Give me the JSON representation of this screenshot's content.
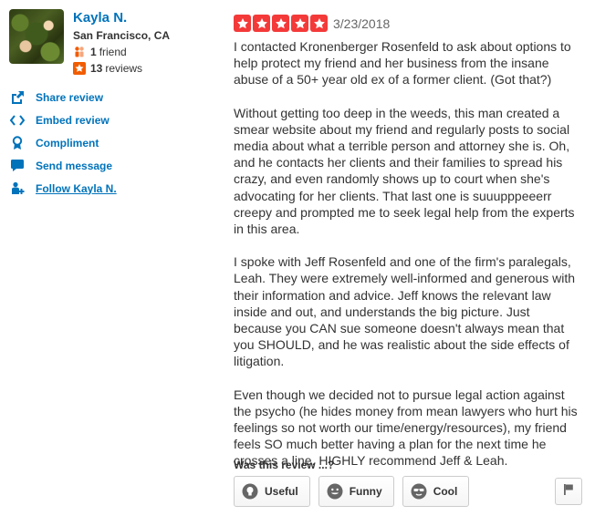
{
  "user": {
    "name": "Kayla N.",
    "location": "San Francisco, CA",
    "friends_count": "1",
    "friends_label": "friend",
    "reviews_count": "13",
    "reviews_label": "reviews"
  },
  "actions": {
    "share": "Share review",
    "embed": "Embed review",
    "compliment": "Compliment",
    "message": "Send message",
    "follow": "Follow Kayla N."
  },
  "review": {
    "rating": 5,
    "date": "3/23/2018",
    "paragraphs": [
      "I contacted Kronenberger Rosenfeld to ask about options to help protect my friend and her business from the insane abuse of a 50+ year old ex of a former client. (Got that?)",
      "Without getting too deep in the weeds, this man created a smear website about my friend and regularly posts to social media about what a terrible person and attorney she is. Oh, and he contacts her clients and their families to spread his crazy, and even randomly shows up to court when she's advocating for her clients. That last one is suuupppeeerr creepy and prompted me to seek legal help from the experts in this area.",
      "I spoke with Jeff Rosenfeld and one of the firm's paralegals, Leah. They were extremely well-informed and generous with their information and advice. Jeff knows the relevant law inside and out, and understands the big picture. Just because you CAN sue someone doesn't always mean that you SHOULD, and he was realistic about the side effects of litigation.",
      "Even though we decided not to pursue legal action against the psycho (he hides money from mean lawyers who hurt his feelings so not worth our time/energy/resources), my friend feels SO much better having a plan for the next time he crosses a line. HIGHLY recommend Jeff & Leah."
    ]
  },
  "feedback": {
    "question": "Was this review ...?",
    "useful": "Useful",
    "funny": "Funny",
    "cool": "Cool"
  },
  "colors": {
    "link": "#0073bb",
    "star": "#f43939",
    "friend_icon": "#f15c00",
    "review_icon": "#f15c00"
  },
  "icons": {
    "friends": "friends-icon",
    "reviews": "review-star-icon",
    "share": "share-icon",
    "embed": "embed-icon",
    "compliment": "compliment-icon",
    "message": "message-icon",
    "follow": "follow-icon",
    "useful": "lightbulb-icon",
    "funny": "smiley-icon",
    "cool": "sunglasses-icon",
    "flag": "flag-icon"
  }
}
